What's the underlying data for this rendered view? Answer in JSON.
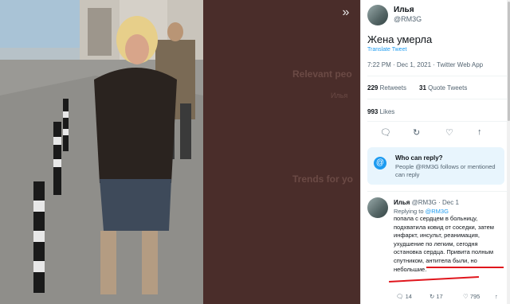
{
  "viewer": {
    "expand_icon": "double-chevron-right-icon",
    "background_text": {
      "relevant_people": "Relevant peo",
      "trends": "Trends for yo"
    }
  },
  "tweet": {
    "author_name": "Илья",
    "author_handle": "@RM3G",
    "text": "Жена умерла",
    "translate_label": "Translate Tweet",
    "meta": "7:22 PM · Dec 1, 2021 · Twitter Web App",
    "retweets_count": "229",
    "retweets_label": "Retweets",
    "quotes_count": "31",
    "quotes_label": "Quote Tweets",
    "likes_count": "993",
    "likes_label": "Likes"
  },
  "actions": {
    "reply_icon": "reply-icon",
    "retweet_icon": "retweet-icon",
    "like_icon": "heart-icon",
    "share_icon": "share-icon"
  },
  "reply_card": {
    "title": "Who can reply?",
    "body": "People @RM3G follows or mentioned can reply"
  },
  "reply": {
    "author_name": "Илья",
    "author_handle": "@RM3G",
    "date": "· Dec 1",
    "replying_prefix": "Replying to",
    "replying_handle": "@RM3G",
    "text_plain": "попала с сердцем в больницу, подхватила ковид от соседки, затем инфаркт, инсульт, реанимация, ухудшение по легким, сегодня остановка сердца. ",
    "text_underlined": "Привита полным спутником, антитела были, но небольшие.",
    "reply_count": "14",
    "retweet_count": "17",
    "like_count": "795"
  },
  "colors": {
    "accent": "#1d9bf0",
    "underline": "#e0161d"
  }
}
